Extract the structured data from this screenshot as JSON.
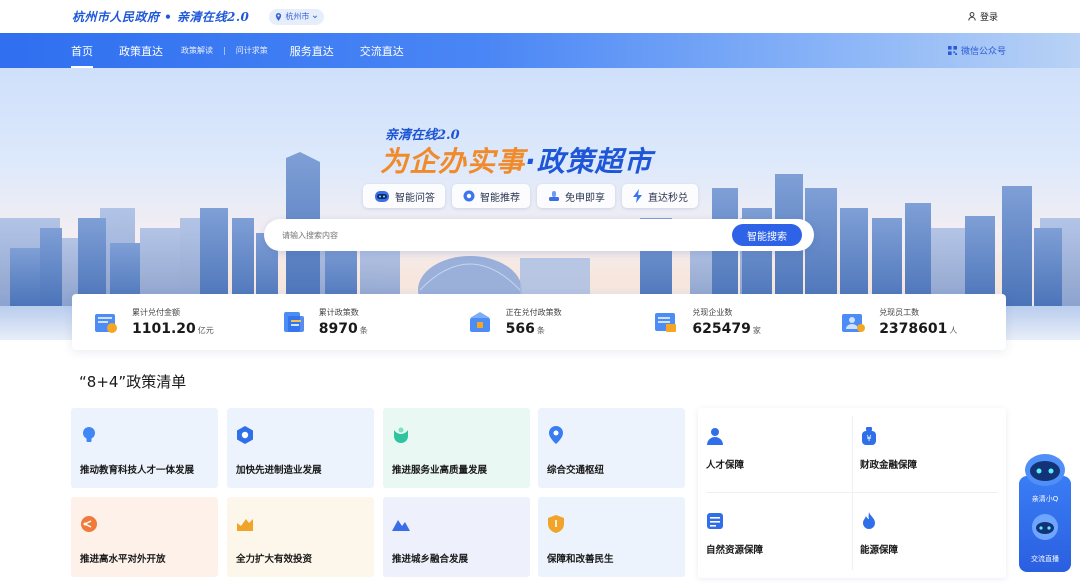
{
  "header": {
    "brand": "杭州市人民政府 • 亲清在线2.0",
    "location": "杭州市",
    "login": "登录"
  },
  "nav": {
    "items": [
      "首页",
      "政策直达"
    ],
    "subitems": [
      "政策解读",
      "|",
      "问计求策"
    ],
    "items2": [
      "服务直达",
      "交流直达"
    ],
    "wechat": "微信公众号"
  },
  "hero": {
    "slogan_small": "亲清在线2.0",
    "slogan_big_a": "为企办实事",
    "slogan_dot": "·",
    "slogan_big_b": "政策超市",
    "features": [
      {
        "icon": "robot-icon",
        "label": "智能问答"
      },
      {
        "icon": "gear-icon",
        "label": "智能推荐"
      },
      {
        "icon": "hand-icon",
        "label": "免申即享"
      },
      {
        "icon": "lightning-icon",
        "label": "直达秒兑"
      }
    ],
    "search_placeholder": "请输入搜索内容",
    "search_button": "智能搜索"
  },
  "stats": [
    {
      "label": "累计兑付金额",
      "value": "1101.20",
      "unit": "亿元"
    },
    {
      "label": "累计政策数",
      "value": "8970",
      "unit": "条"
    },
    {
      "label": "正在兑付政策数",
      "value": "566",
      "unit": "条"
    },
    {
      "label": "兑现企业数",
      "value": "625479",
      "unit": "家"
    },
    {
      "label": "兑现员工数",
      "value": "2378601",
      "unit": "人"
    }
  ],
  "section": {
    "title": "“8+4”政策清单",
    "cards": [
      {
        "label": "推动教育科技人才一体发展",
        "icon": "bulb-icon",
        "bg": "#edf3fd",
        "color": "#3f87f5"
      },
      {
        "label": "加快先进制造业发展",
        "icon": "nut-icon",
        "bg": "#edf3fd",
        "color": "#2f6fea"
      },
      {
        "label": "推进服务业高质量发展",
        "icon": "service-icon",
        "bg": "#eaf8f3",
        "color": "#2ec4a0"
      },
      {
        "label": "综合交通枢纽",
        "icon": "location-icon",
        "bg": "#edf3fd",
        "color": "#3a7df0"
      },
      {
        "label": "推进高水平对外开放",
        "icon": "share-icon",
        "bg": "#fdf1ea",
        "color": "#f07a3a"
      },
      {
        "label": "全力扩大有效投资",
        "icon": "trend-icon",
        "bg": "#fdf6ea",
        "color": "#f0a52a"
      },
      {
        "label": "推进城乡融合发展",
        "icon": "mountain-icon",
        "bg": "#eef1fb",
        "color": "#3a6ee8"
      },
      {
        "label": "保障和改善民生",
        "icon": "shield-icon",
        "bg": "#edf3fd",
        "color": "#f0a52a"
      }
    ],
    "panel": [
      {
        "label": "人才保障",
        "icon": "talent-icon"
      },
      {
        "label": "财政金融保障",
        "icon": "money-bag-icon"
      },
      {
        "label": "自然资源保障",
        "icon": "document-icon"
      },
      {
        "label": "能源保障",
        "icon": "flame-icon"
      }
    ]
  },
  "float": {
    "label1": "亲清小Q",
    "label2": "交流直播"
  }
}
